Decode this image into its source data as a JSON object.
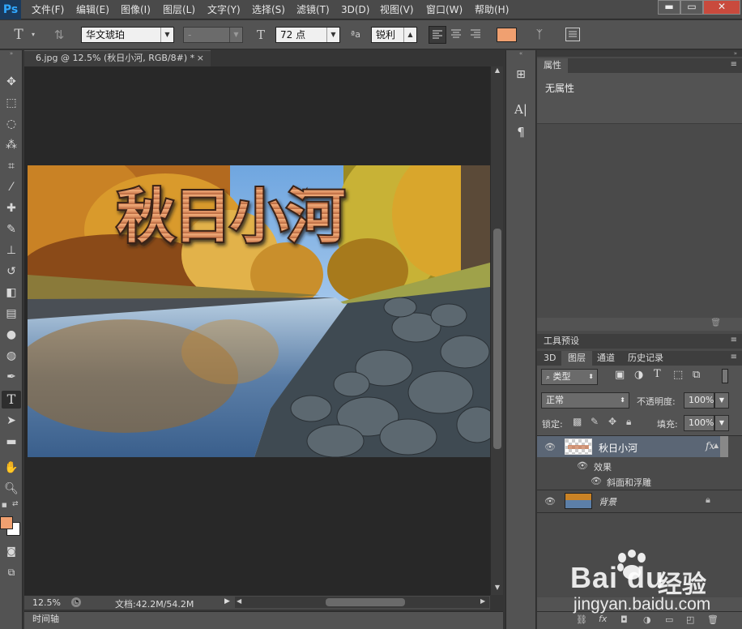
{
  "app": {
    "logo": "Ps"
  },
  "menu": [
    "文件(F)",
    "编辑(E)",
    "图像(I)",
    "图层(L)",
    "文字(Y)",
    "选择(S)",
    "滤镜(T)",
    "3D(D)",
    "视图(V)",
    "窗口(W)",
    "帮助(H)"
  ],
  "window_controls": {
    "minimize": "▬",
    "maximize": "▭",
    "close": "✕"
  },
  "options": {
    "tool_letter": "T",
    "font_family": "华文琥珀",
    "font_style": "-",
    "font_size": "72 点",
    "aa_icon": "ªa",
    "antialias": "锐利",
    "text_color": "#f0a070"
  },
  "document": {
    "tab_title": "6.jpg @ 12.5% (秋日小河, RGB/8#) *",
    "close": "×",
    "text_layer_text": "秋日小河",
    "zoom": "12.5%",
    "doc_size": "文档:42.2M/54.2M"
  },
  "timeline": {
    "label": "时间轴"
  },
  "panels": {
    "properties": {
      "tab": "属性",
      "content": "无属性"
    },
    "tool_presets": {
      "tab": "工具预设"
    },
    "layer_tabs": [
      "3D",
      "图层",
      "通道",
      "历史记录"
    ],
    "filter_kind": "类型",
    "blend_mode": "正常",
    "opacity_label": "不透明度:",
    "opacity_value": "100%",
    "lock_label": "锁定:",
    "fill_label": "填充:",
    "fill_value": "100%",
    "layers": [
      {
        "name": "秋日小河",
        "fx": "fx",
        "effects_label": "效果",
        "effect": "斜面和浮雕"
      },
      {
        "name": "背景"
      }
    ]
  },
  "watermark": {
    "brand": "Bai du",
    "cn": "经验",
    "url": "jingyan.baidu.com"
  },
  "colors": {
    "foreground": "#f0a070",
    "background": "#ffffff",
    "accent": "#31a8ff"
  }
}
